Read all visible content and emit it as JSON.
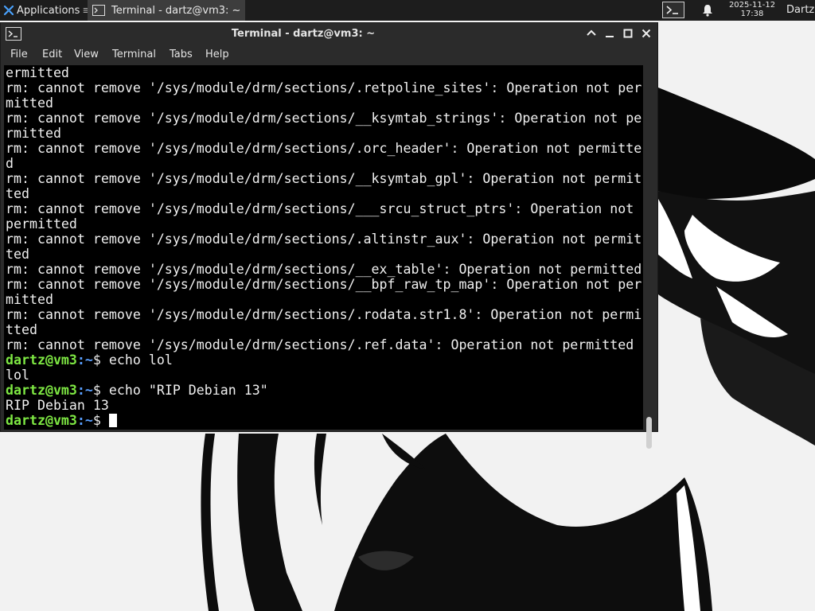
{
  "panel": {
    "applications_label": "Applications",
    "task_title": "Terminal - dartz@vm3: ~",
    "clock_date": "2025-11-12",
    "clock_time": "17:38",
    "user_label": "Dartz"
  },
  "window": {
    "title": "Terminal - dartz@vm3: ~",
    "menu": [
      "File",
      "Edit",
      "View",
      "Terminal",
      "Tabs",
      "Help"
    ]
  },
  "terminal": {
    "lines": [
      "ermitted",
      "rm: cannot remove '/sys/module/drm/sections/.retpoline_sites': Operation not per",
      "mitted",
      "rm: cannot remove '/sys/module/drm/sections/__ksymtab_strings': Operation not pe",
      "rmitted",
      "rm: cannot remove '/sys/module/drm/sections/.orc_header': Operation not permitte",
      "d",
      "rm: cannot remove '/sys/module/drm/sections/__ksymtab_gpl': Operation not permit",
      "ted",
      "rm: cannot remove '/sys/module/drm/sections/___srcu_struct_ptrs': Operation not",
      "permitted",
      "rm: cannot remove '/sys/module/drm/sections/.altinstr_aux': Operation not permit",
      "ted",
      "rm: cannot remove '/sys/module/drm/sections/__ex_table': Operation not permitted",
      "rm: cannot remove '/sys/module/drm/sections/__bpf_raw_tp_map': Operation not per",
      "mitted",
      "rm: cannot remove '/sys/module/drm/sections/.rodata.str1.8': Operation not permi",
      "tted",
      "rm: cannot remove '/sys/module/drm/sections/.ref.data': Operation not permitted"
    ],
    "prompt_user": "dartz@vm3",
    "prompt_path": ":~",
    "prompt_symbol": "$",
    "cmd1": " echo lol",
    "out1": "lol",
    "cmd2": " echo \"RIP Debian 13\"",
    "out2": "RIP Debian 13",
    "prompt_user_color": "#7ee843",
    "prompt_path_color": "#5aa0ff"
  }
}
